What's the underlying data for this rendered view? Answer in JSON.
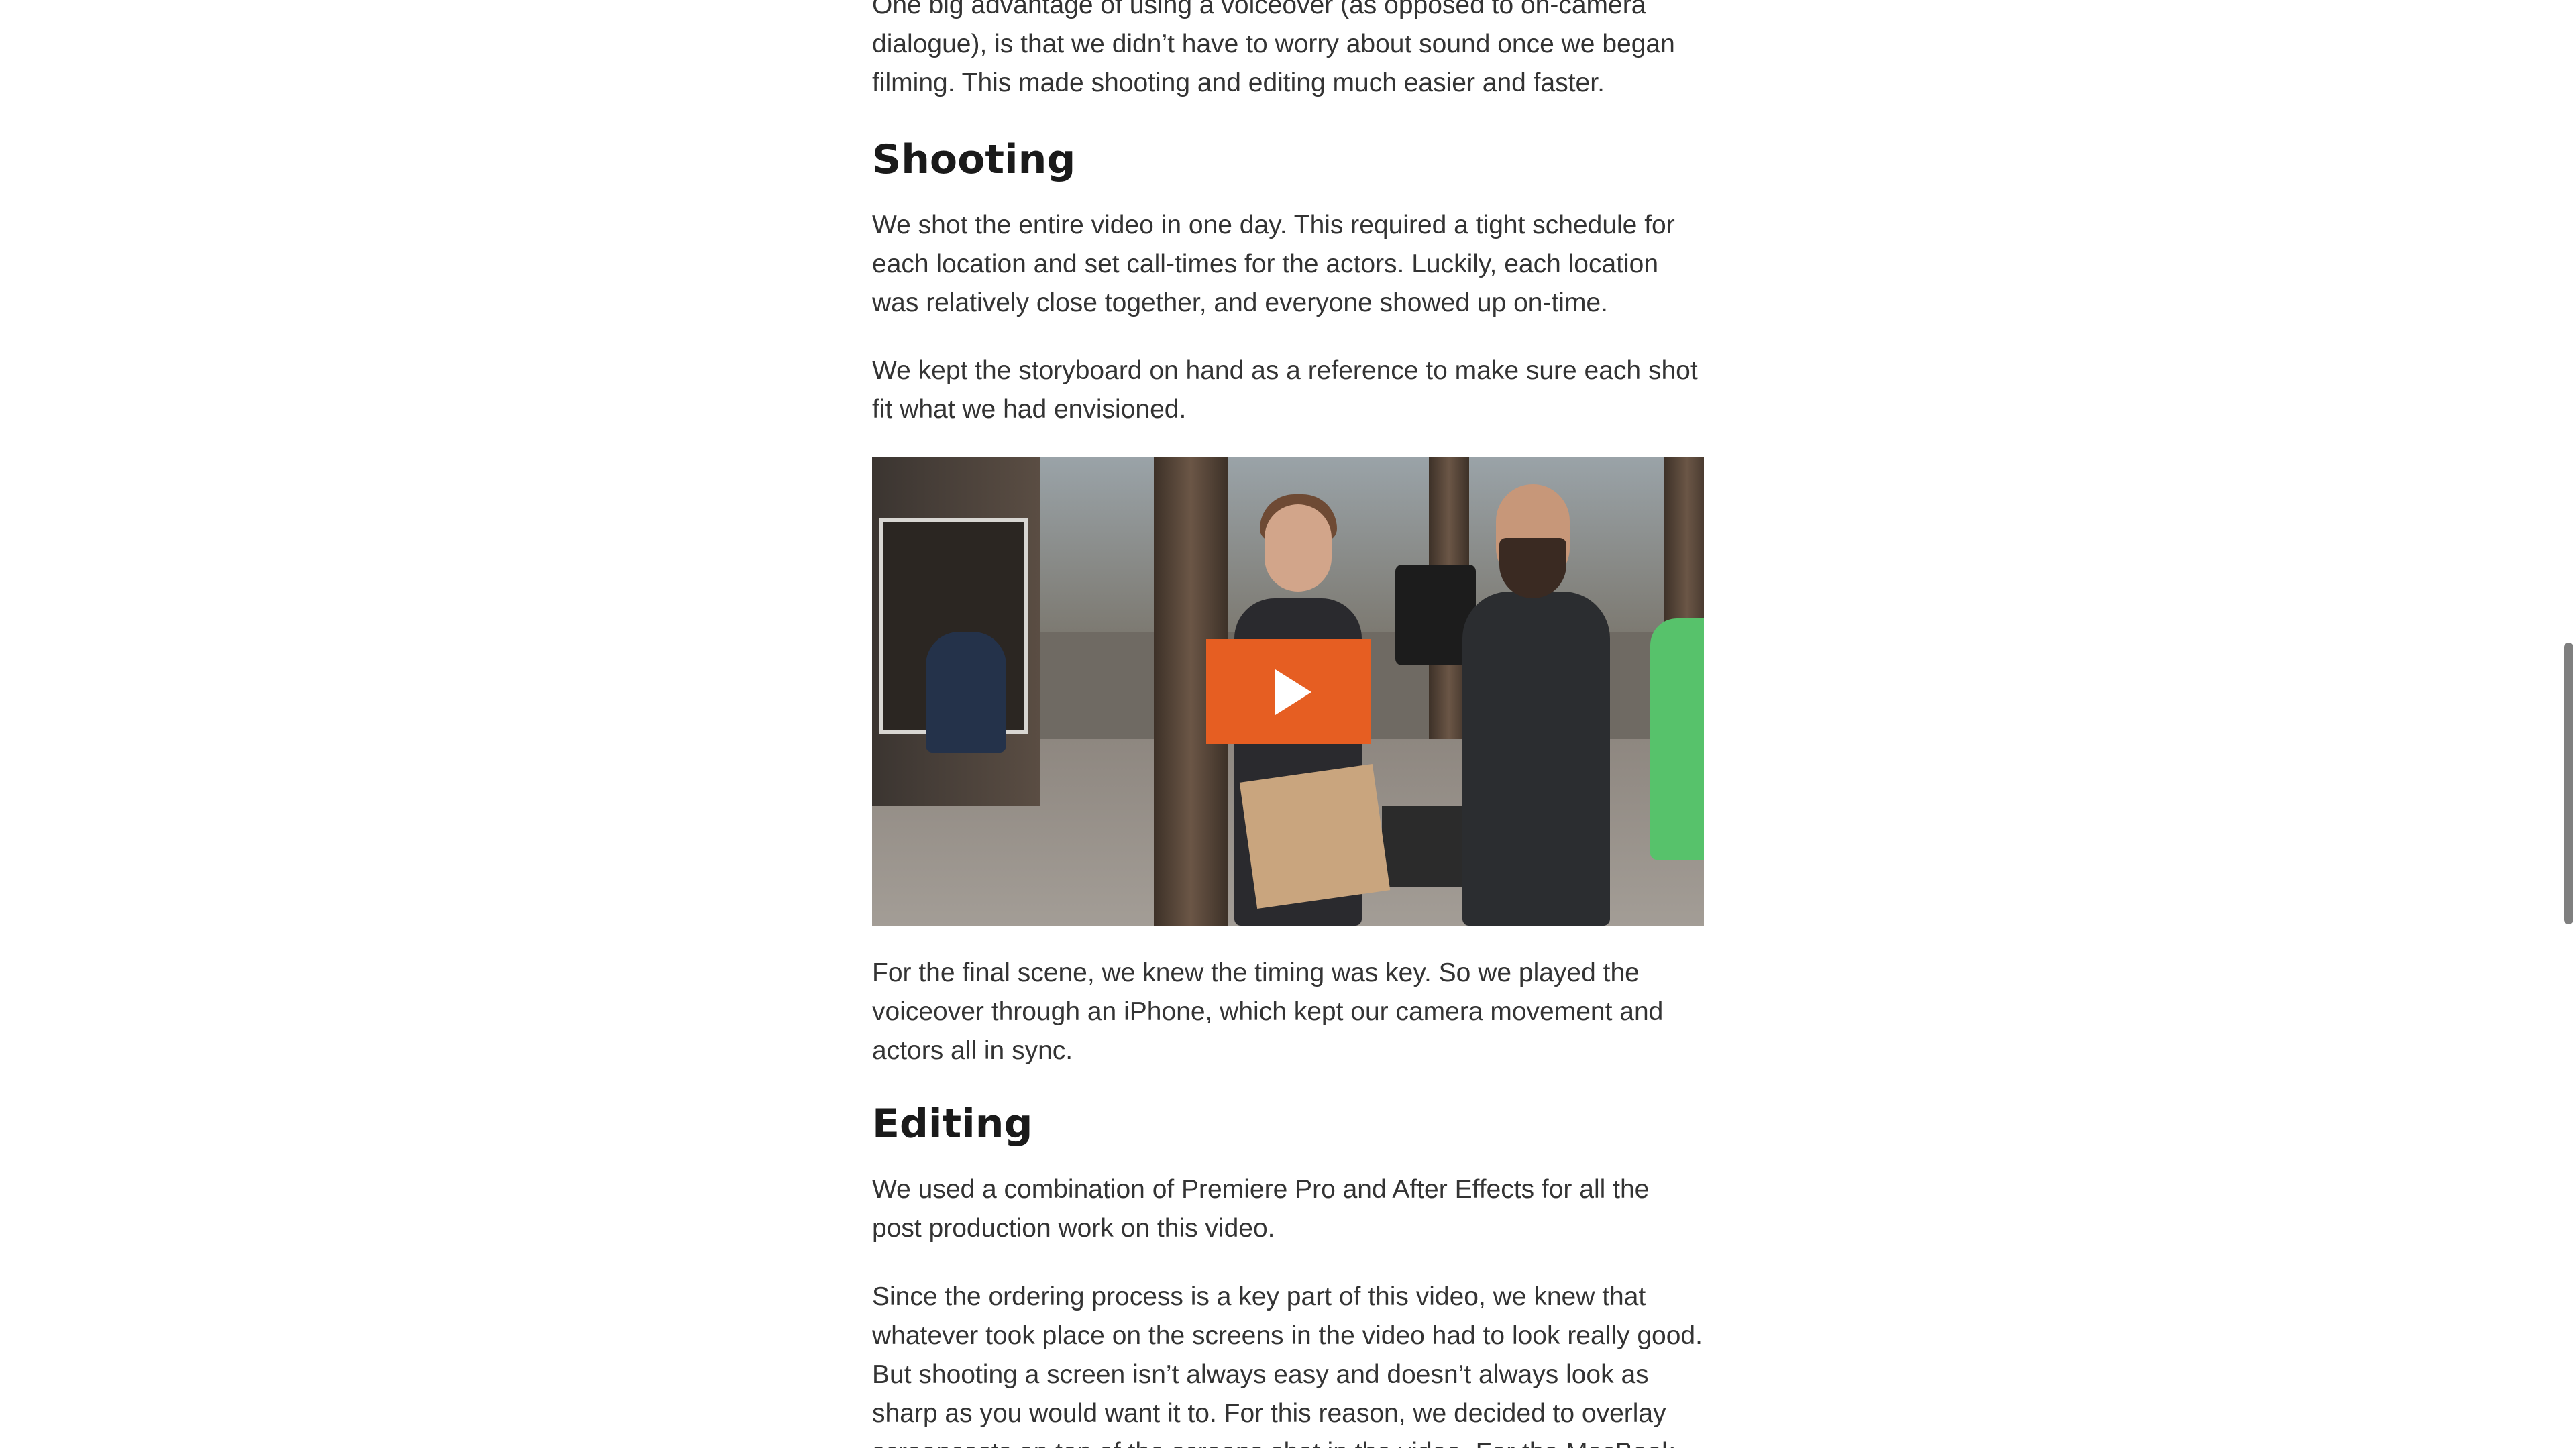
{
  "article": {
    "intro_paragraph": "One big advantage of using a voiceover (as opposed to on-camera dialogue), is that we didn’t have to worry about sound once we began filming. This made shooting and editing much easier and faster.",
    "shooting_heading": "Shooting",
    "shooting_paragraph_1": "We shot the entire video in one day. This required a tight schedule for each location and set call-times for the actors. Luckily, each location was relatively close together, and everyone showed up on-time.",
    "shooting_paragraph_2": "We kept the storyboard on hand as a reference to make sure each shot fit what we had envisioned.",
    "video": {
      "play_icon": "play-icon",
      "play_button_color": "#E65E22"
    },
    "final_scene_paragraph": "For the final scene, we knew the timing was key. So we played the voiceover through an iPhone, which kept our camera movement and actors all in sync.",
    "editing_heading": "Editing",
    "editing_paragraph_1": "We used a combination of Premiere Pro and After Effects for all the post production work on this video.",
    "editing_paragraph_2": "Since the ordering process is a key part of this video, we knew that whatever took place on the screens in the video had to look really good. But shooting a screen isn’t always easy and doesn’t always look as sharp as you would want it to. For this reason, we decided to overlay screencasts on top of the screens shot in the video. For the MacBook and iMac, this"
  }
}
